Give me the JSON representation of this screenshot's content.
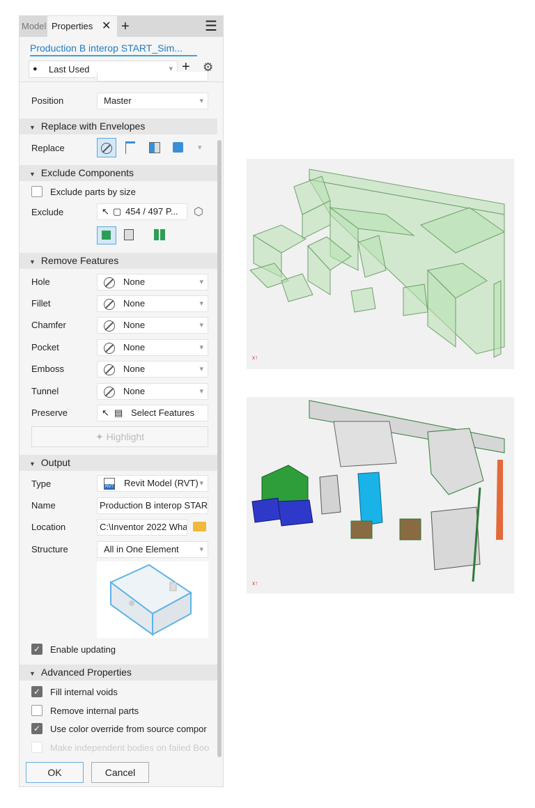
{
  "tabs": {
    "model": "Model",
    "properties": "Properties",
    "close": "✕",
    "add": "+",
    "menu": "☰"
  },
  "header": {
    "title": "Production B interop START_Sim...",
    "preset": "Last Used",
    "add": "+",
    "settings": "⚙"
  },
  "position": {
    "label": "Position",
    "value": "Master"
  },
  "replace_section": {
    "title": "Replace with Envelopes",
    "replace_label": "Replace"
  },
  "exclude_section": {
    "title": "Exclude Components",
    "exclude_by_size": "Exclude parts by size",
    "exclude_by_size_checked": false,
    "exclude_label": "Exclude",
    "exclude_value": "454 / 497 P..."
  },
  "remove_features": {
    "title": "Remove Features",
    "rows": [
      {
        "label": "Hole",
        "value": "None"
      },
      {
        "label": "Fillet",
        "value": "None"
      },
      {
        "label": "Chamfer",
        "value": "None"
      },
      {
        "label": "Pocket",
        "value": "None"
      },
      {
        "label": "Emboss",
        "value": "None"
      },
      {
        "label": "Tunnel",
        "value": "None"
      }
    ],
    "preserve_label": "Preserve",
    "preserve_value": "Select Features",
    "highlight": "Highlight"
  },
  "output": {
    "title": "Output",
    "type_label": "Type",
    "type_value": "Revit Model (RVT)",
    "type_icon_text": "RVT",
    "name_label": "Name",
    "name_value": "Production B interop START",
    "location_label": "Location",
    "location_value": "C:\\Inventor 2022 Wha",
    "structure_label": "Structure",
    "structure_value": "All in One Element",
    "enable_updating": "Enable updating",
    "enable_updating_checked": true
  },
  "advanced": {
    "title": "Advanced Properties",
    "options": [
      {
        "label": "Fill internal voids",
        "checked": true,
        "enabled": true
      },
      {
        "label": "Remove internal parts",
        "checked": false,
        "enabled": true
      },
      {
        "label": "Use color override from source compor",
        "checked": true,
        "enabled": true
      },
      {
        "label": "Make independent bodies on failed Boo",
        "checked": false,
        "enabled": false
      }
    ]
  },
  "footer": {
    "ok": "OK",
    "cancel": "Cancel"
  },
  "colors": {
    "accent": "#1f8dd6",
    "envelope": "#b6e0b0",
    "select_bg": "#d4e8f7"
  }
}
